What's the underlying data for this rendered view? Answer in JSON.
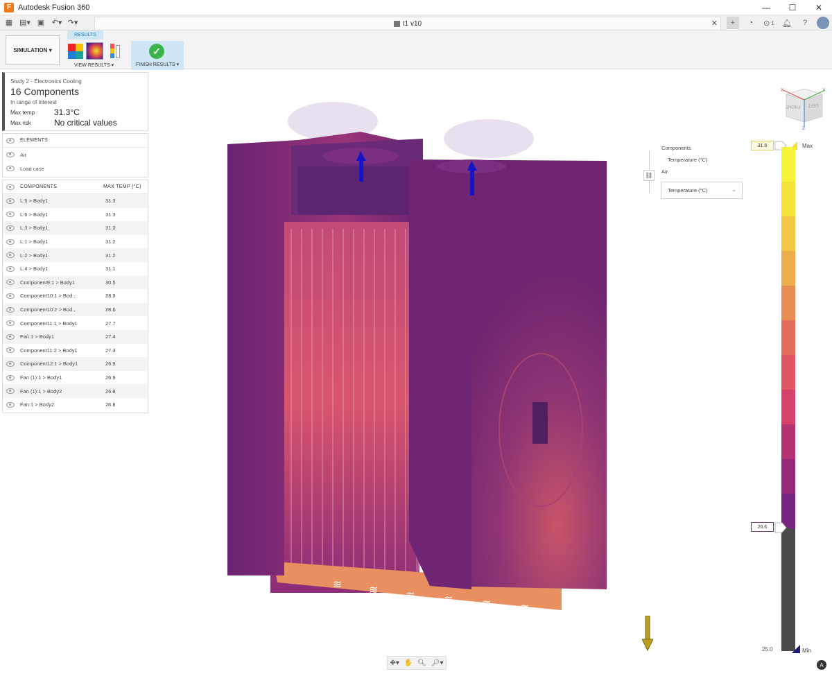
{
  "app": {
    "title": "Autodesk Fusion 360",
    "logo": "F"
  },
  "window_controls": {
    "minimize": "—",
    "maximize": "☐",
    "close": "✕"
  },
  "document": {
    "tab": "t1 v10",
    "close": "✕"
  },
  "header": {
    "jobs_count": "1",
    "plus": "+"
  },
  "ribbon": {
    "workspace": "SIMULATION",
    "results_tab": "RESULTS",
    "view_results": "VIEW RESULTS",
    "finish_results": "FINISH RESULTS"
  },
  "study": {
    "name": "Study 2 - Electronics Cooling",
    "count": "16 Components",
    "range": "In range of interest",
    "max_temp_label": "Max temp",
    "max_temp_value": "31.3°C",
    "max_risk_label": "Max risk",
    "max_risk_value": "No critical values"
  },
  "elements": {
    "title": "ELEMENTS",
    "items": [
      "Air",
      "Load case"
    ]
  },
  "components": {
    "title": "COMPONENTS",
    "col": "MAX TEMP (°C)",
    "rows": [
      {
        "name": "L:5 > Body1",
        "value": "31.3"
      },
      {
        "name": "L:6 > Body1",
        "value": "31.3"
      },
      {
        "name": "L:3 > Body1",
        "value": "31.3"
      },
      {
        "name": "L:1 > Body1",
        "value": "31.2"
      },
      {
        "name": "L:2 > Body1",
        "value": "31.2"
      },
      {
        "name": "L:4 > Body1",
        "value": "31.1"
      },
      {
        "name": "Component9:1 > Body1",
        "value": "30.5"
      },
      {
        "name": "Component10:1 > Bod...",
        "value": "28.9"
      },
      {
        "name": "Component10:2 > Bod...",
        "value": "28.6"
      },
      {
        "name": "Component11:1 > Body1",
        "value": "27.7"
      },
      {
        "name": "Fan:1 > Body1",
        "value": "27.4"
      },
      {
        "name": "Component11:2 > Body1",
        "value": "27.3"
      },
      {
        "name": "Component12:1 > Body1",
        "value": "26.9"
      },
      {
        "name": "Fan (1):1 > Body1",
        "value": "26.9"
      },
      {
        "name": "Fan (1):1 > Body2",
        "value": "26.8"
      },
      {
        "name": "Fan:1 > Body2",
        "value": "26.8"
      }
    ]
  },
  "legend": {
    "components_label": "Components",
    "components_type": "Temperature (°C)",
    "air_label": "Air",
    "air_select": "Temperature (°C)",
    "max_label": "Max",
    "min_label": "Min",
    "max_value": "31.6",
    "mid_value": "26.6",
    "min_value": "25.0",
    "colors": [
      "#f4f33a",
      "#f3e33b",
      "#f2c944",
      "#eead4c",
      "#e98e53",
      "#e46d59",
      "#df5561",
      "#d5416a",
      "#b33470",
      "#95297a",
      "#762480",
      "#4a4a4a"
    ]
  },
  "navcube": {
    "front": "FRONT",
    "left": "LEFT",
    "x": "X",
    "y": "Y",
    "z": "Z"
  },
  "icons": [
    "apps-icon",
    "file-icon",
    "save-icon",
    "undo-icon",
    "redo-icon",
    "close-icon",
    "plus-icon",
    "jobs-icon",
    "notifications-icon",
    "help-icon",
    "avatar",
    "link-icon",
    "chevron-down-icon",
    "pan-icon",
    "orbit-icon",
    "zoom-icon",
    "gravity-arrow-icon"
  ]
}
